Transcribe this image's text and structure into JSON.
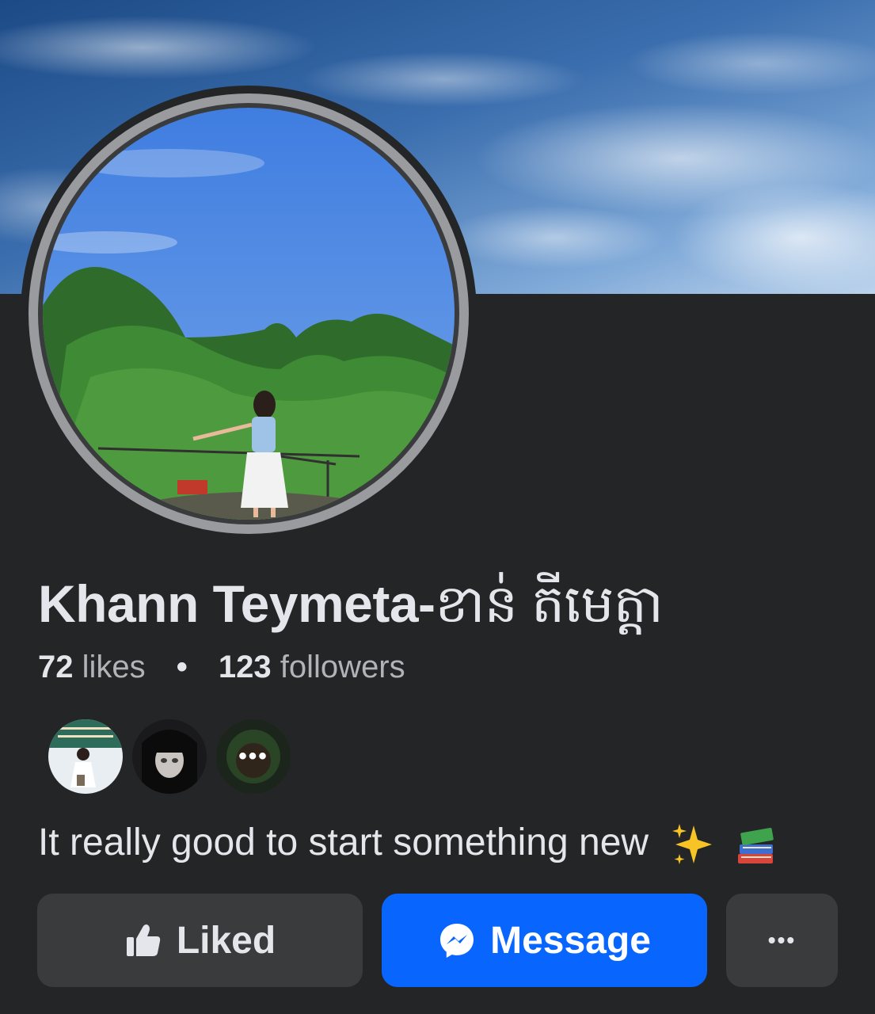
{
  "page": {
    "name_latin": "Khann Teymeta-",
    "name_khmer": "ខាន់ តីមេត្តា",
    "likes_count": "72",
    "likes_label": "likes",
    "separator": "•",
    "followers_count": "123",
    "followers_label": "followers",
    "bio": "It really good to start something new",
    "bio_emojis": [
      "sparkles-icon",
      "books-icon"
    ]
  },
  "friends_preview": {
    "avatars": [
      "friend-avatar-1",
      "friend-avatar-2",
      "friend-avatar-3"
    ],
    "overflow_indicator": "•••"
  },
  "actions": {
    "liked_label": "Liked",
    "message_label": "Message",
    "more_label": "•••"
  },
  "colors": {
    "background": "#242526",
    "button_secondary": "#3a3b3c",
    "button_primary": "#0866ff",
    "text_primary": "#e4e6eb",
    "text_secondary": "#b0b3b8"
  }
}
